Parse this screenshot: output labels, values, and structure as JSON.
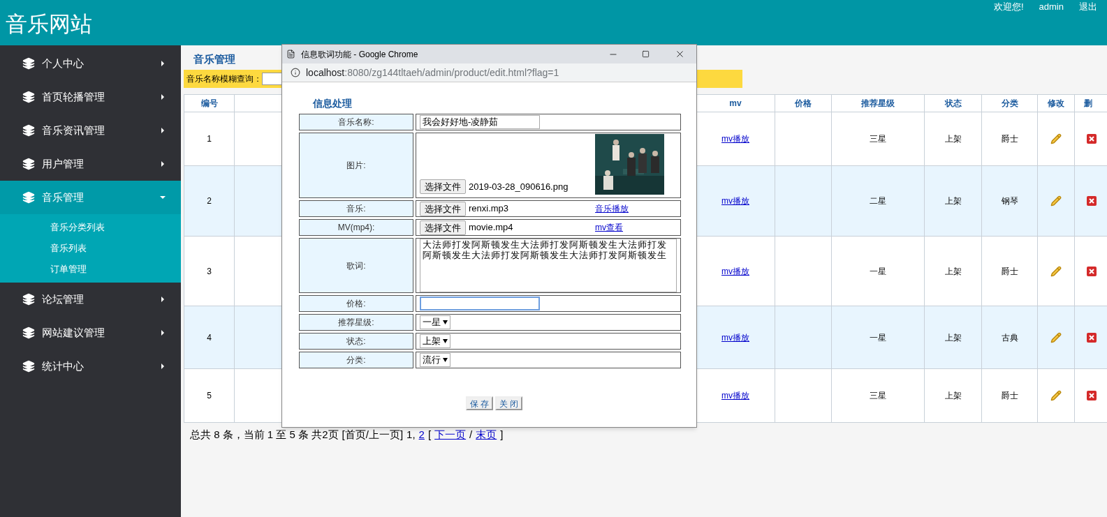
{
  "header": {
    "title": "音乐网站",
    "welcome": "欢迎您!",
    "user": "admin",
    "logout": "退出"
  },
  "sidebar": {
    "items": [
      {
        "label": "个人中心",
        "expanded": false
      },
      {
        "label": "首页轮播管理",
        "expanded": false
      },
      {
        "label": "音乐资讯管理",
        "expanded": false
      },
      {
        "label": "用户管理",
        "expanded": false
      },
      {
        "label": "音乐管理",
        "expanded": true,
        "children": [
          {
            "label": "音乐分类列表"
          },
          {
            "label": "音乐列表"
          },
          {
            "label": "订单管理"
          }
        ]
      },
      {
        "label": "论坛管理",
        "expanded": false
      },
      {
        "label": "网站建议管理",
        "expanded": false
      },
      {
        "label": "统计中心",
        "expanded": false
      }
    ]
  },
  "main": {
    "section_title": "音乐管理",
    "search": {
      "label": "音乐名称模糊查询："
    },
    "table": {
      "columns": [
        "编号",
        "mv",
        "价格",
        "推荐星级",
        "状态",
        "分类",
        "修改",
        "删"
      ],
      "rows": [
        {
          "number": "1",
          "mv_link": "mv播放",
          "rating": "三星",
          "status": "上架",
          "category": "爵士"
        },
        {
          "number": "2",
          "mv_link": "mv播放",
          "rating": "二星",
          "status": "上架",
          "category": "钢琴"
        },
        {
          "number": "3",
          "mv_link": "mv播放",
          "rating": "一星",
          "status": "上架",
          "category": "爵士"
        },
        {
          "number": "4",
          "mv_link": "mv播放",
          "rating": "一星",
          "status": "上架",
          "category": "古典"
        },
        {
          "number": "5",
          "mv_link": "mv播放",
          "rating": "三星",
          "status": "上架",
          "category": "爵士"
        }
      ]
    },
    "pagination": [
      {
        "kind": "text",
        "text": "总共 8 条，当前 1 至 5 条 共2页"
      },
      {
        "kind": "text",
        "text": "[首页/上一页]"
      },
      {
        "kind": "text",
        "text": "1,"
      },
      {
        "kind": "link",
        "text": "2"
      },
      {
        "kind": "text",
        "text": "["
      },
      {
        "kind": "link",
        "text": "下一页"
      },
      {
        "kind": "text",
        "text": "/"
      },
      {
        "kind": "link",
        "text": "末页"
      },
      {
        "kind": "text",
        "text": "]"
      }
    ]
  },
  "dialog": {
    "title": "信息歌词功能 - Google Chrome",
    "url_host": "localhost",
    "url_rest": ":8080/zg144tltaeh/admin/product/edit.html?flag=1",
    "heading": "信息处理",
    "fields": [
      {
        "kind": "text",
        "label": "音乐名称:",
        "value": "我会好好地-凌静茹",
        "focused": false
      },
      {
        "label": "图片:",
        "button": "选择文件",
        "file": "2019-03-28_090616.png"
      },
      {
        "kind": "file",
        "label": "音乐:",
        "button": "选择文件",
        "file": "renxi.mp3",
        "link": "音乐播放"
      },
      {
        "kind": "file",
        "label": "MV(mp4):",
        "button": "选择文件",
        "file": "movie.mp4",
        "link": "mv查看"
      },
      {
        "kind": "textarea",
        "label": "歌词:",
        "value": "大法师打发阿斯顿发生大法师打发阿斯顿发生大法师打发阿斯顿发生大法师打发阿斯顿发生大法师打发阿斯顿发生"
      },
      {
        "kind": "text",
        "label": "价格:",
        "focused": true
      },
      {
        "kind": "select",
        "label": "推荐星级:",
        "value": "一星"
      },
      {
        "kind": "select",
        "label": "状态:",
        "value": "上架"
      },
      {
        "kind": "select",
        "label": "分类:",
        "value": "流行"
      }
    ],
    "buttons": [
      "保 存",
      "关 闭"
    ]
  }
}
